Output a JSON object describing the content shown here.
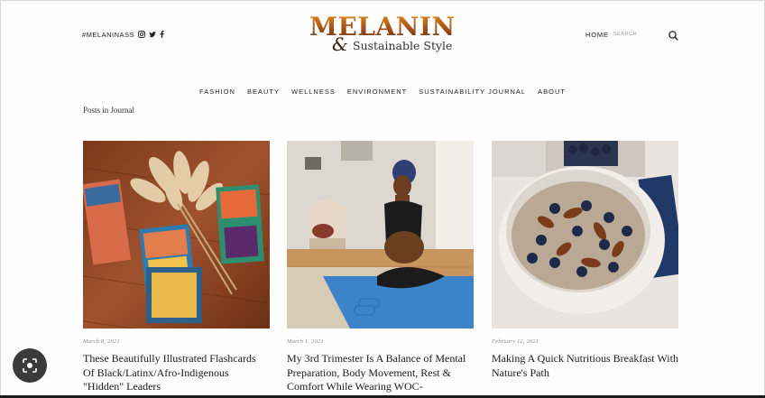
{
  "header": {
    "social_handle": "#MELANINASS",
    "social_icons": [
      "instagram-icon",
      "twitter-icon",
      "facebook-icon"
    ],
    "logo_title": "MELANIN",
    "logo_amp": "&",
    "logo_tagline": "Sustainable Style",
    "home_label": "HOME",
    "search_placeholder": "SEARCH"
  },
  "nav": {
    "items": [
      {
        "label": "FASHION"
      },
      {
        "label": "BEAUTY"
      },
      {
        "label": "WELLNESS"
      },
      {
        "label": "ENVIRONMENT"
      },
      {
        "label": "SUSTAINABILITY JOURNAL"
      },
      {
        "label": "ABOUT"
      }
    ]
  },
  "section_label": "Posts in Journal",
  "posts": [
    {
      "date": "March 8, 2021",
      "title": "These Beautifully Illustrated Flashcards Of Black/Latinx/Afro-Indigenous \"Hidden\" Leaders",
      "image": "flashcards-photo"
    },
    {
      "date": "March 1, 2021",
      "title": "My 3rd Trimester Is A Balance of Mental Preparation, Body Movement, Rest & Comfort While Wearing WOC-",
      "image": "yoga-pregnancy-photo"
    },
    {
      "date": "February 12, 2021",
      "title": "Making A Quick Nutritious Breakfast With Nature's Path",
      "image": "oatmeal-bowl-photo"
    }
  ],
  "colors": {
    "logo_orange": "#b5651d",
    "text": "#222222",
    "date_gray": "#8a8a8a"
  }
}
